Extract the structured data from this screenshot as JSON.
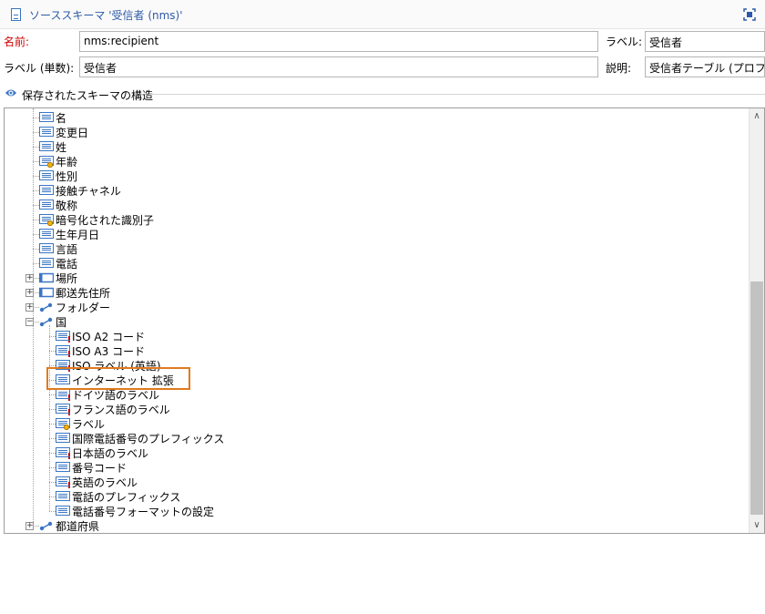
{
  "window": {
    "title": "ソーススキーマ '受信者 (nms)'"
  },
  "form": {
    "name_label": "名前:",
    "name_value": "nms:recipient",
    "label_label": "ラベル:",
    "label_value": "受信者",
    "singular_label": "ラベル (単数):",
    "singular_value": "受信者",
    "desc_label": "説明:",
    "desc_value": "受信者テーブル (プロファ"
  },
  "section": {
    "title": "保存されたスキーマの構造"
  },
  "tree": {
    "items": [
      {
        "label": "名",
        "icon": "field"
      },
      {
        "label": "変更日",
        "icon": "field"
      },
      {
        "label": "姓",
        "icon": "field"
      },
      {
        "label": "年齢",
        "icon": "calc-field"
      },
      {
        "label": "性別",
        "icon": "field"
      },
      {
        "label": "接触チャネル",
        "icon": "field"
      },
      {
        "label": "敬称",
        "icon": "field"
      },
      {
        "label": "暗号化された識別子",
        "icon": "calc-field"
      },
      {
        "label": "生年月日",
        "icon": "field"
      },
      {
        "label": "言語",
        "icon": "field"
      },
      {
        "label": "電話",
        "icon": "field"
      },
      {
        "label": "場所",
        "icon": "element",
        "expander": "+"
      },
      {
        "label": "郵送先住所",
        "icon": "element",
        "expander": "+"
      },
      {
        "label": "フォルダー",
        "icon": "link",
        "expander": "+"
      },
      {
        "label": "国",
        "icon": "link",
        "expander": "-"
      },
      {
        "label": "ISO A2 コード",
        "icon": "field-req"
      },
      {
        "label": "ISO A3 コード",
        "icon": "field-req"
      },
      {
        "label": "ISO ラベル (英語)",
        "icon": "field-req"
      },
      {
        "label": "インターネット 拡張",
        "icon": "field"
      },
      {
        "label": "ドイツ語のラベル",
        "icon": "field-req"
      },
      {
        "label": "フランス語のラベル",
        "icon": "field-req"
      },
      {
        "label": "ラベル",
        "icon": "calc-field"
      },
      {
        "label": "国際電話番号のプレフィックス",
        "icon": "field"
      },
      {
        "label": "日本語のラベル",
        "icon": "field-req"
      },
      {
        "label": "番号コード",
        "icon": "field"
      },
      {
        "label": "英語のラベル",
        "icon": "field-req"
      },
      {
        "label": "電話のプレフィックス",
        "icon": "field"
      },
      {
        "label": "電話番号フォーマットの設定",
        "icon": "field"
      },
      {
        "label": "都道府県",
        "icon": "link",
        "expander": "+"
      }
    ]
  },
  "colors": {
    "highlight": "#e07a1f",
    "title": "#2d5aa8",
    "required": "#cc0000",
    "icon": "#3a76c4"
  }
}
